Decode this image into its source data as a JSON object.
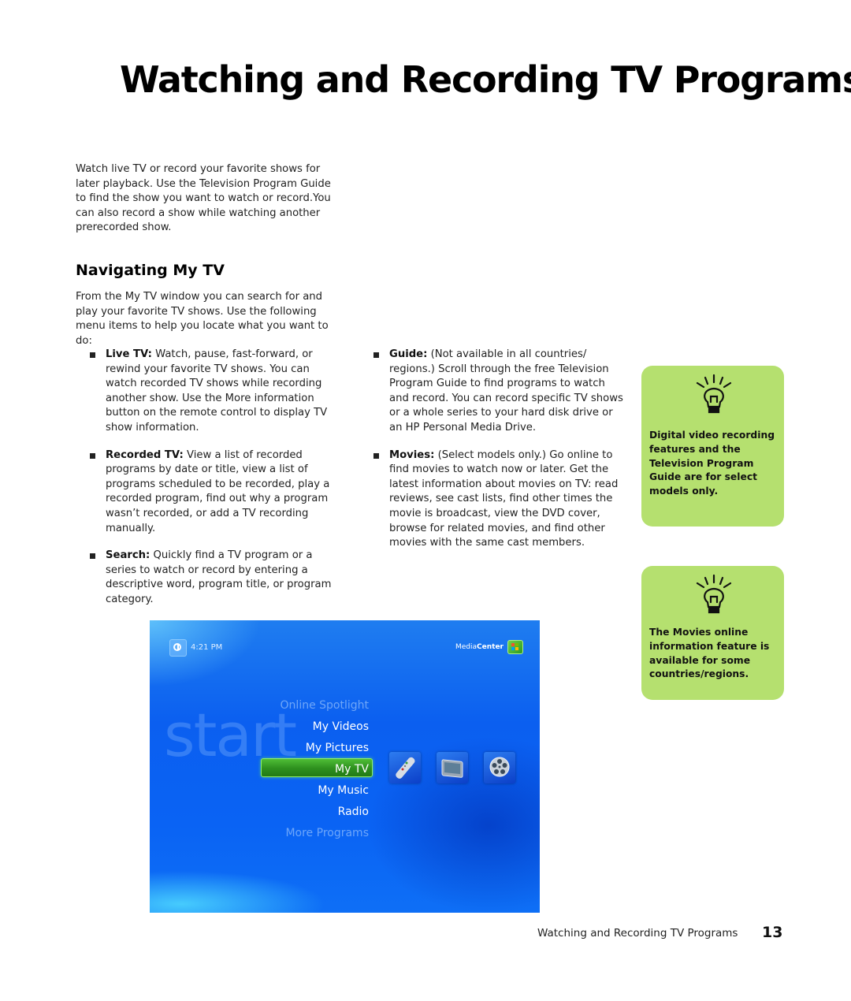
{
  "page": {
    "title": "Watching and Recording TV Programs",
    "intro": "Watch live TV or record your favorite shows for later playback. Use the Television Program Guide to find the show you want to watch or record.You can also record a show while watching another prerecorded show.",
    "section_heading": "Navigating My TV",
    "section_intro": "From the My TV window you can search for and play your favorite TV shows. Use the following menu items to help you locate what you want to do:"
  },
  "bullets_left": [
    {
      "term": "Live TV:",
      "text": " Watch, pause, fast-forward, or rewind your favorite TV shows. You can watch recorded TV shows while recording another show. Use the More information button on the remote control to display TV show information."
    },
    {
      "term": "Recorded TV:",
      "text": " View a list of recorded programs by date or title, view a list of programs scheduled to be recorded, play a recorded program, find out why a program wasn’t recorded, or add a TV recording manually."
    },
    {
      "term": "Search:",
      "text": " Quickly find a TV program or a series to watch or record by entering a descriptive word, program title, or program category."
    }
  ],
  "bullets_right": [
    {
      "term": "Guide:",
      "text": " (Not available in all countries/ regions.) Scroll through the free Television Program Guide to find programs to watch and record. You can record specific TV shows or a whole series to your hard disk drive or an HP Personal Media Drive."
    },
    {
      "term": "Movies:",
      "text": " (Select models only.) Go online to find movies to watch now or later. Get the latest information about movies on TV: read reviews, see cast lists, find other times the movie is broadcast, view the DVD cover, browse for related movies, and find other movies with the same cast members."
    }
  ],
  "tips": [
    {
      "icon": "lightbulb-icon",
      "text": "Digital video recording features and the Television Program Guide are for select models only."
    },
    {
      "icon": "lightbulb-icon",
      "text": "The Movies online information feature is available for some countries/regions."
    }
  ],
  "screenshot": {
    "time": "4:21 PM",
    "brand_light": "Media",
    "brand_bold": "Center",
    "watermark": "start",
    "menu_items": [
      {
        "label": "Online Spotlight",
        "state": "faded"
      },
      {
        "label": "My Videos",
        "state": "normal"
      },
      {
        "label": "My Pictures",
        "state": "normal"
      },
      {
        "label": "My TV",
        "state": "selected"
      },
      {
        "label": "My Music",
        "state": "normal"
      },
      {
        "label": "Radio",
        "state": "normal"
      },
      {
        "label": "More Programs",
        "state": "faded"
      }
    ],
    "tiles": [
      "remote-control-icon",
      "tv-monitor-icon",
      "film-reel-icon"
    ],
    "colors": {
      "background": "#0b5ff0",
      "selection": "#2d8f1e"
    }
  },
  "footer": {
    "running_title": "Watching and Recording TV Programs",
    "page_number": "13"
  },
  "colors": {
    "tip_background": "#b5e06f"
  }
}
